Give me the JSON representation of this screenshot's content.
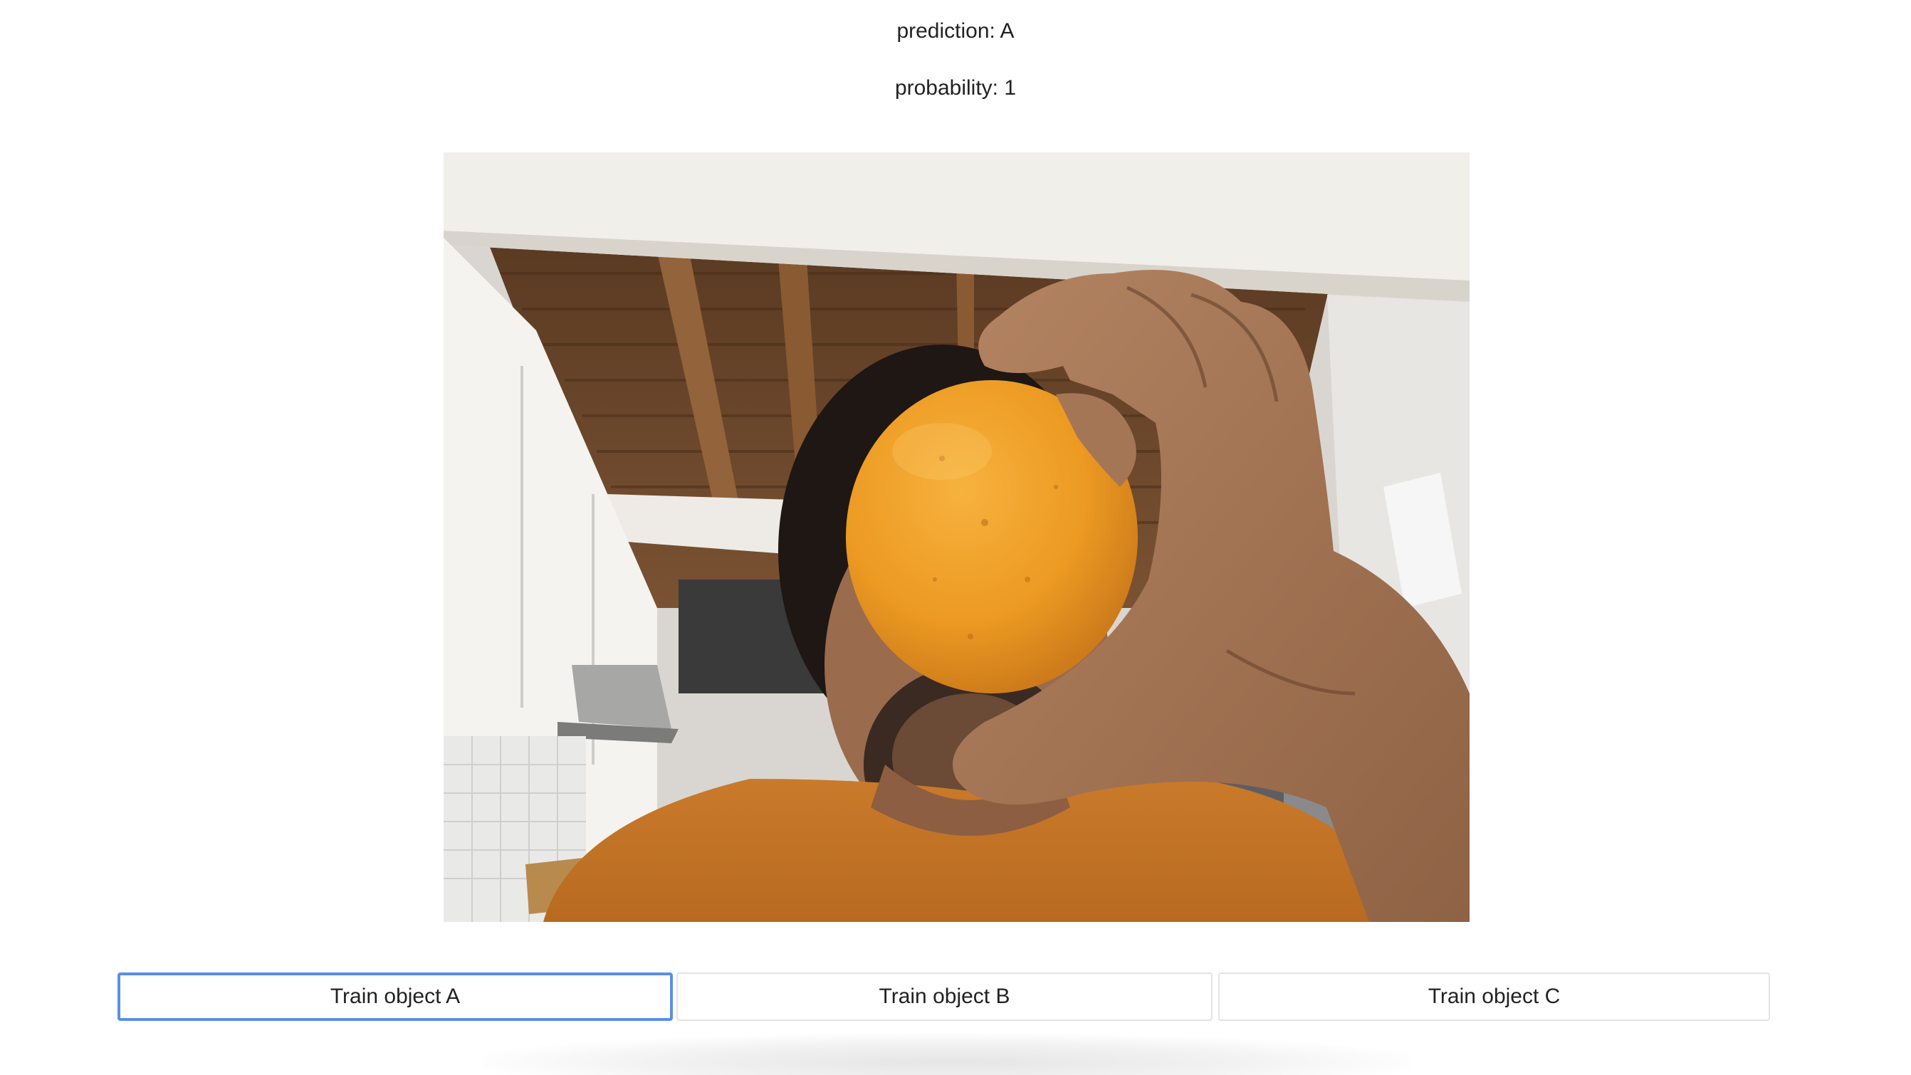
{
  "status": {
    "prediction_label": "prediction: A",
    "probability_label": "probability: 1"
  },
  "video": {
    "subject": "webcam frame of a person holding an orange in front of face in a kitchen"
  },
  "buttons": [
    {
      "label": "Train object A",
      "focused": true
    },
    {
      "label": "Train object B",
      "focused": false
    },
    {
      "label": "Train object C",
      "focused": false
    }
  ],
  "colors": {
    "focus_ring": "#5b8dec",
    "button_border": "#e3e3e3",
    "text": "#222222"
  }
}
